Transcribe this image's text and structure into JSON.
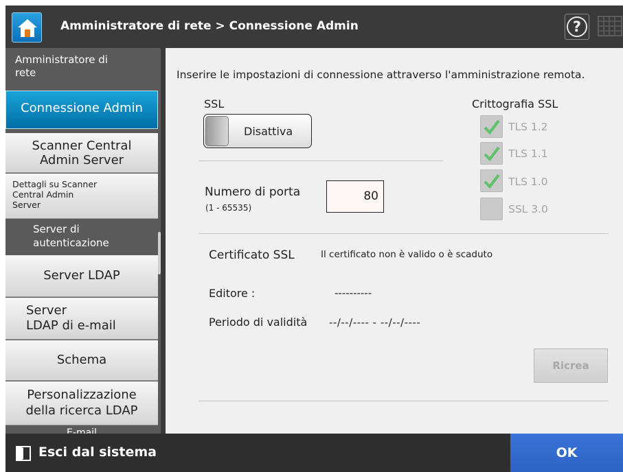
{
  "header": {
    "title": "Amministratore di rete > Connessione Admin",
    "help_symbol": "?",
    "accent_color": "#1b8fd2"
  },
  "sidebar": {
    "items": [
      {
        "label_lines": [
          "Amministratore di",
          "rete"
        ],
        "state": "category"
      },
      {
        "label_lines": [
          "Connessione Admin"
        ],
        "state": "active"
      },
      {
        "label_lines": [
          "Scanner Central",
          "Admin Server"
        ],
        "state": "normal"
      },
      {
        "label_lines": [
          "Dettagli su Scanner",
          "Central Admin",
          "Server"
        ],
        "state": "normal"
      },
      {
        "label_lines": [
          "Server di",
          "autenticazione"
        ],
        "state": "category"
      },
      {
        "label_lines": [
          "Server LDAP"
        ],
        "state": "normal"
      },
      {
        "label_lines": [
          "Server",
          "LDAP di e-mail"
        ],
        "state": "normal"
      },
      {
        "label_lines": [
          "Schema"
        ],
        "state": "normal"
      },
      {
        "label_lines": [
          "Personalizzazione",
          "della ricerca LDAP"
        ],
        "state": "normal"
      },
      {
        "label_lines": [
          "E-mail"
        ],
        "state": "category"
      }
    ]
  },
  "main": {
    "intro": "Inserire le impostazioni di connessione attraverso l'amministrazione remota.",
    "ssl": {
      "label": "SSL",
      "toggle_text": "Disattiva",
      "state": "off"
    },
    "port": {
      "label": "Numero di porta",
      "range": "(1 - 65535)",
      "value": "80"
    },
    "encryption": {
      "title": "Crittografia SSL",
      "options": [
        {
          "label": "TLS 1.2",
          "checked": true,
          "enabled": false
        },
        {
          "label": "TLS 1.1",
          "checked": true,
          "enabled": false
        },
        {
          "label": "TLS 1.0",
          "checked": true,
          "enabled": false
        },
        {
          "label": "SSL 3.0",
          "checked": false,
          "enabled": false
        }
      ]
    },
    "certificate": {
      "label": "Certificato SSL",
      "status": "Il certificato non è valido o è scaduto",
      "publisher_label": "Editore :",
      "publisher_value": "----------",
      "validity_label": "Periodo di validità",
      "validity_value": "--/--/---- - --/--/----",
      "recreate_label": "Ricrea"
    }
  },
  "footer": {
    "logout_label": "Esci dal sistema",
    "ok_label": "OK"
  }
}
